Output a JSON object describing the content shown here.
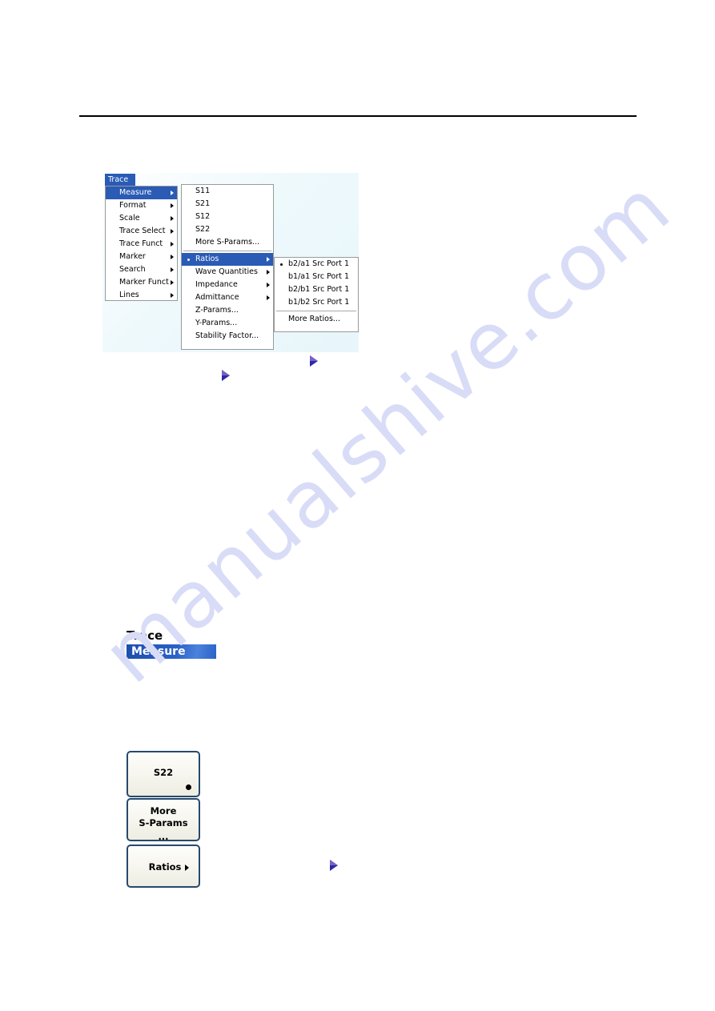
{
  "page": {
    "background_color": "#ffffff",
    "rule_color": "#000000"
  },
  "watermark": {
    "text": "manualshive.com",
    "color": "#d9dcf7"
  },
  "screenshot": {
    "panel_background": "#e7f6fb",
    "app_title": "Trace",
    "accent_color": "#2a5bb5",
    "menu_level1": {
      "items": [
        {
          "label": "Measure",
          "submenu": true,
          "selected": true
        },
        {
          "label": "Format",
          "submenu": true,
          "selected": false
        },
        {
          "label": "Scale",
          "submenu": true,
          "selected": false
        },
        {
          "label": "Trace Select",
          "submenu": true,
          "selected": false
        },
        {
          "label": "Trace Funct",
          "submenu": true,
          "selected": false
        },
        {
          "label": "Marker",
          "submenu": true,
          "selected": false
        },
        {
          "label": "Search",
          "submenu": true,
          "selected": false
        },
        {
          "label": "Marker Funct",
          "submenu": true,
          "selected": false
        },
        {
          "label": "Lines",
          "submenu": true,
          "selected": false
        }
      ]
    },
    "menu_level2": {
      "items": [
        {
          "label": "S11",
          "submenu": false,
          "selected": false,
          "bullet": false
        },
        {
          "label": "S21",
          "submenu": false,
          "selected": false,
          "bullet": false
        },
        {
          "label": "S12",
          "submenu": false,
          "selected": false,
          "bullet": false
        },
        {
          "label": "S22",
          "submenu": false,
          "selected": false,
          "bullet": false
        },
        {
          "label": "More S-Params...",
          "submenu": false,
          "selected": false,
          "bullet": false
        },
        {
          "separator": true
        },
        {
          "label": "Ratios",
          "submenu": true,
          "selected": true,
          "bullet": true
        },
        {
          "label": "Wave Quantities",
          "submenu": true,
          "selected": false,
          "bullet": false
        },
        {
          "label": "Impedance",
          "submenu": true,
          "selected": false,
          "bullet": false
        },
        {
          "label": "Admittance",
          "submenu": true,
          "selected": false,
          "bullet": false
        },
        {
          "label": "Z-Params...",
          "submenu": false,
          "selected": false,
          "bullet": false
        },
        {
          "label": "Y-Params...",
          "submenu": false,
          "selected": false,
          "bullet": false
        },
        {
          "label": "Stability Factor...",
          "submenu": false,
          "selected": false,
          "bullet": false
        }
      ]
    },
    "menu_level3": {
      "items": [
        {
          "label": "b2/a1 Src Port 1",
          "submenu": false,
          "selected": false,
          "bullet": true
        },
        {
          "label": "b1/a1 Src Port 1",
          "submenu": false,
          "selected": false,
          "bullet": false
        },
        {
          "label": "b2/b1 Src Port 1",
          "submenu": false,
          "selected": false,
          "bullet": false
        },
        {
          "label": "b1/b2 Src Port 1",
          "submenu": false,
          "selected": false,
          "bullet": false
        },
        {
          "separator": true
        },
        {
          "label": "More Ratios...",
          "submenu": false,
          "selected": false,
          "bullet": false
        }
      ]
    }
  },
  "softkey_panel": {
    "title": "Trace",
    "subtitle": "Measure",
    "subtitle_color": "#2a62c8",
    "keys": [
      {
        "label": "S22",
        "line2": "",
        "line3": "",
        "state_dot": true,
        "submenu": false
      },
      {
        "label": "More",
        "line2": "S-Params",
        "line3": "...",
        "state_dot": false,
        "submenu": false
      },
      {
        "label": "Ratios",
        "line2": "",
        "line3": "",
        "state_dot": false,
        "submenu": true
      }
    ]
  },
  "arrows": {
    "color": "#2a2aa8",
    "count": 3
  }
}
